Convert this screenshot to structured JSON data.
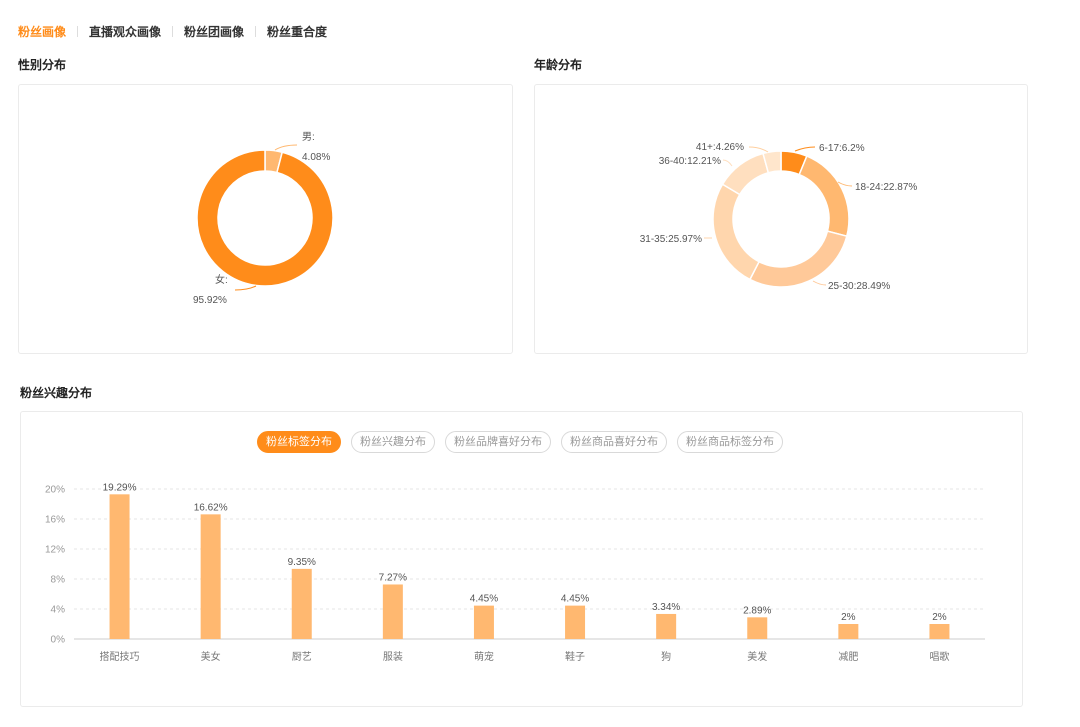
{
  "top_tabs": [
    {
      "label": "粉丝画像",
      "active": true
    },
    {
      "label": "直播观众画像",
      "active": false
    },
    {
      "label": "粉丝团画像",
      "active": false
    },
    {
      "label": "粉丝重合度",
      "active": false
    }
  ],
  "sections": {
    "gender_title": "性别分布",
    "age_title": "年龄分布",
    "interest_title": "粉丝兴趣分布"
  },
  "interest_tabs": [
    {
      "label": "粉丝标签分布",
      "active": true
    },
    {
      "label": "粉丝兴趣分布",
      "active": false
    },
    {
      "label": "粉丝品牌喜好分布",
      "active": false
    },
    {
      "label": "粉丝商品喜好分布",
      "active": false
    },
    {
      "label": "粉丝商品标签分布",
      "active": false
    }
  ],
  "colors": {
    "accent": "#ff8c1a",
    "bar": "#ffb870"
  },
  "chart_data": [
    {
      "type": "pie",
      "variant": "donut",
      "title": "性别分布",
      "slices": [
        {
          "name": "男",
          "value": 4.08,
          "label_name": "男:",
          "label_value": "4.08%",
          "color": "#ffb870"
        },
        {
          "name": "女",
          "value": 95.92,
          "label_name": "女:",
          "label_value": "95.92%",
          "color": "#ff8c1a"
        }
      ]
    },
    {
      "type": "pie",
      "variant": "donut",
      "title": "年龄分布",
      "slices": [
        {
          "name": "6-17",
          "value": 6.2,
          "label": "6-17:6.2%",
          "color": "#ff8c1a"
        },
        {
          "name": "18-24",
          "value": 22.87,
          "label": "18-24:22.87%",
          "color": "#ffb870"
        },
        {
          "name": "25-30",
          "value": 28.49,
          "label": "25-30:28.49%",
          "color": "#ffc999"
        },
        {
          "name": "31-35",
          "value": 25.97,
          "label": "31-35:25.97%",
          "color": "#ffd6ad"
        },
        {
          "name": "36-40",
          "value": 12.21,
          "label": "36-40:12.21%",
          "color": "#ffdfbf"
        },
        {
          "name": "41+",
          "value": 4.26,
          "label": "41+:4.26%",
          "color": "#ffe6cc"
        }
      ]
    },
    {
      "type": "bar",
      "title": "粉丝标签分布",
      "categories": [
        "搭配技巧",
        "美女",
        "厨艺",
        "服装",
        "萌宠",
        "鞋子",
        "狗",
        "美发",
        "减肥",
        "唱歌"
      ],
      "values": [
        19.29,
        16.62,
        9.35,
        7.27,
        4.45,
        4.45,
        3.34,
        2.89,
        2,
        2
      ],
      "value_labels": [
        "19.29%",
        "16.62%",
        "9.35%",
        "7.27%",
        "4.45%",
        "4.45%",
        "3.34%",
        "2.89%",
        "2%",
        "2%"
      ],
      "yticks": [
        "0%",
        "4%",
        "8%",
        "12%",
        "16%",
        "20%"
      ],
      "ylim": [
        0,
        20
      ],
      "grid": true
    }
  ]
}
